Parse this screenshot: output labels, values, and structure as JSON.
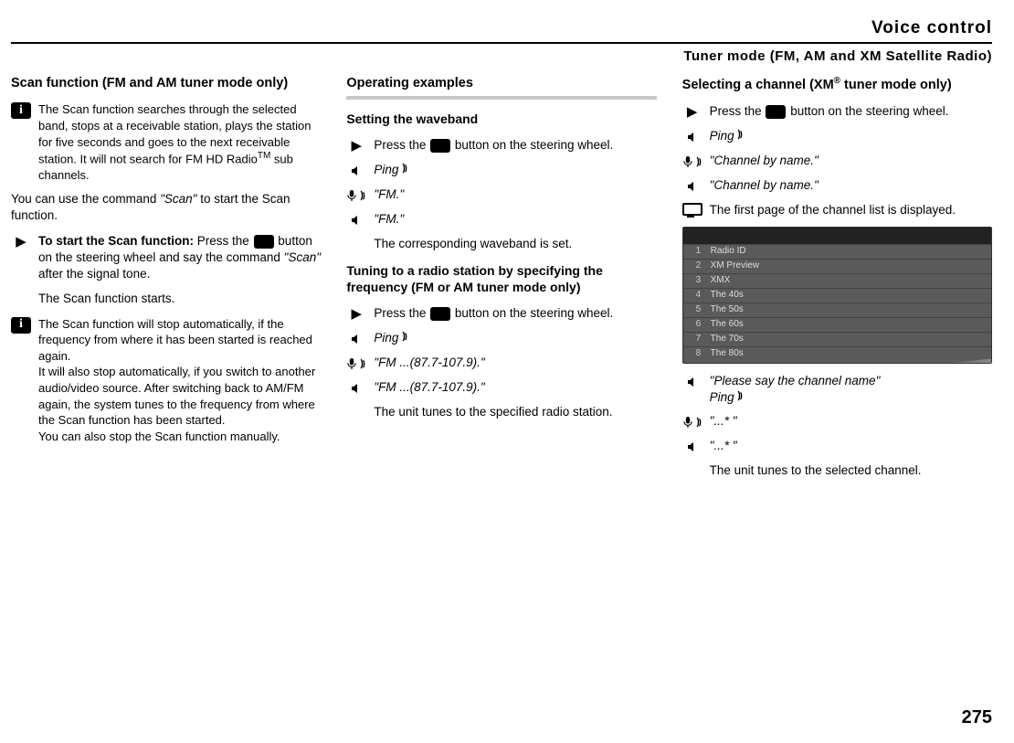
{
  "header": {
    "title": "Voice control",
    "subtitle": "Tuner mode (FM, AM and XM Satellite Radio)"
  },
  "col1": {
    "h": "Scan function (FM and AM tuner mode only)",
    "info1": "The Scan function searches through the selected band, stops at a receivable station, plays the station for five seconds and goes to the next receivable station. It will not search for FM HD Radio",
    "info1_tm": "TM",
    "info1_tail": " sub channels.",
    "p1a": "You can use the command ",
    "p1b": "\"Scan\"",
    "p1c": " to start the Scan function.",
    "step_bold": "To start the Scan function:",
    "step_rest_a": " Press the ",
    "step_rest_b": " button on the steering wheel and say the command ",
    "step_rest_c": "\"Scan\"",
    "step_rest_d": " after the signal tone.",
    "result": "The Scan function starts.",
    "info2": "The Scan function will stop automatically, if the frequency from where it has been started is reached again.\nIt will also stop automatically, if you switch to another audio/video source. After switching back to AM/FM again, the system tunes to the frequency from where the Scan function has been started.\nYou can also stop the Scan function manually."
  },
  "col2": {
    "h": "Operating examples",
    "sub1": "Setting the waveband",
    "press_a": "Press the ",
    "press_b": " button on the steering wheel.",
    "ping": "Ping",
    "fm": "\"FM.\"",
    "fm2": "\"FM.\"",
    "res1": "The corresponding waveband is set.",
    "sub2": "Tuning to a radio station by specifying the frequency (FM or AM tuner mode only)",
    "freq": "\"FM ...(87.7-107.9).\"",
    "freq2": "\"FM ...(87.7-107.9).\"",
    "res2": "The unit tunes to the specified radio station."
  },
  "col3": {
    "h_a": "Selecting a channel (XM",
    "h_r": "®",
    "h_b": " tuner mode only)",
    "press_a": "Press the ",
    "press_b": " button on the steering wheel.",
    "ping": "Ping",
    "cbn": "\"Channel by name.\"",
    "cbn2": "\"Channel by name.\"",
    "screen": "The first page of the channel list is displayed.",
    "list": [
      "Radio ID",
      "XM Preview",
      "XMX",
      "The 40s",
      "The 50s",
      "The 60s",
      "The 70s",
      "The 80s"
    ],
    "say_a": "\"Please say the channel name\"",
    "say_b": "Ping",
    "dots1": "\"...* \"",
    "dots2": "\"...* \"",
    "final": "The unit tunes to the selected channel."
  },
  "page": "275"
}
